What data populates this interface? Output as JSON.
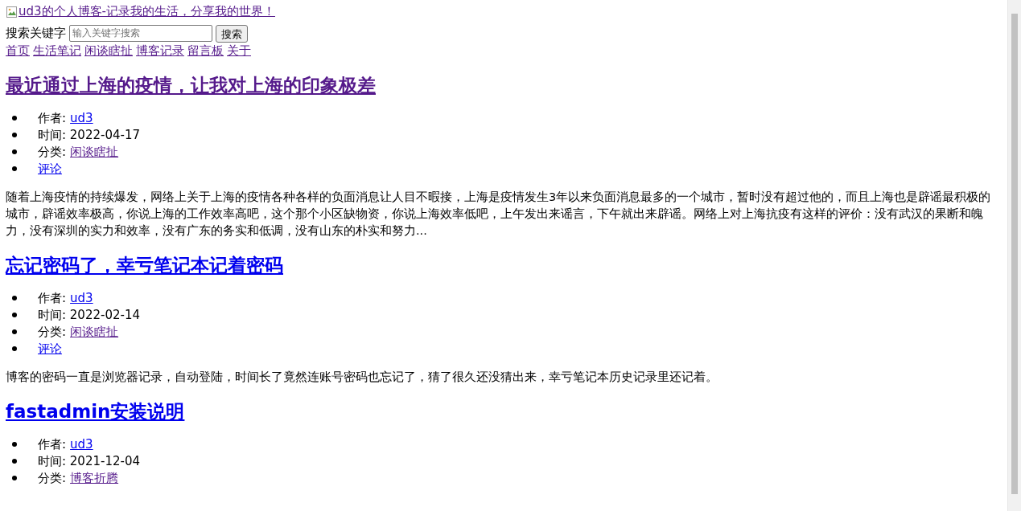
{
  "header": {
    "logo_alt": "ud3的个人博客-记录我的生活，分享我的世界！",
    "logo_visited": true,
    "search_label": "搜索关键字",
    "search_placeholder": "输入关键字搜索",
    "search_button": "搜索"
  },
  "nav": [
    {
      "label": "首页",
      "visited": true
    },
    {
      "label": "生活笔记",
      "visited": true
    },
    {
      "label": "闲谈瞎扯",
      "visited": true
    },
    {
      "label": "博客记录",
      "visited": true
    },
    {
      "label": "留言板",
      "visited": true
    },
    {
      "label": "关于",
      "visited": true
    }
  ],
  "posts": [
    {
      "title": "最近通过上海的疫情，让我对上海的印象极差",
      "visited": true,
      "meta": [
        {
          "kind": "label_link",
          "label": "作者:",
          "value": "ud3",
          "visited": false
        },
        {
          "kind": "text",
          "label": "时间:",
          "value": "2022-04-17"
        },
        {
          "kind": "label_link",
          "label": "分类:",
          "value": "闲谈瞎扯",
          "visited": true
        },
        {
          "kind": "link",
          "value": "评论",
          "visited": false
        }
      ],
      "excerpt": "随着上海疫情的持续爆发，网络上关于上海的疫情各种各样的负面消息让人目不暇接，上海是疫情发生3年以来负面消息最多的一个城市，暂时没有超过他的，而且上海也是辟谣最积极的城市，辟谣效率极高，你说上海的工作效率高吧，这个那个小区缺物资，你说上海效率低吧，上午发出来谣言，下午就出来辟谣。网络上对上海抗疫有这样的评价：没有武汉的果断和魄力，没有深圳的实力和效率，没有广东的务实和低调，没有山东的朴实和努力..."
    },
    {
      "title": "忘记密码了，幸亏笔记本记着密码",
      "visited": false,
      "meta": [
        {
          "kind": "label_link",
          "label": "作者:",
          "value": "ud3",
          "visited": false
        },
        {
          "kind": "text",
          "label": "时间:",
          "value": "2022-02-14"
        },
        {
          "kind": "label_link",
          "label": "分类:",
          "value": "闲谈瞎扯",
          "visited": true
        },
        {
          "kind": "link",
          "value": "评论",
          "visited": false
        }
      ],
      "excerpt": "博客的密码一直是浏览器记录，自动登陆，时间长了竟然连账号密码也忘记了，猜了很久还没猜出来，幸亏笔记本历史记录里还记着。"
    },
    {
      "title": "fastadmin安装说明",
      "visited": false,
      "meta": [
        {
          "kind": "label_link",
          "label": "作者:",
          "value": "ud3",
          "visited": false
        },
        {
          "kind": "text",
          "label": "时间:",
          "value": "2021-12-04"
        },
        {
          "kind": "label_link",
          "label": "分类:",
          "value": "博客折腾",
          "visited": true
        }
      ]
    }
  ]
}
